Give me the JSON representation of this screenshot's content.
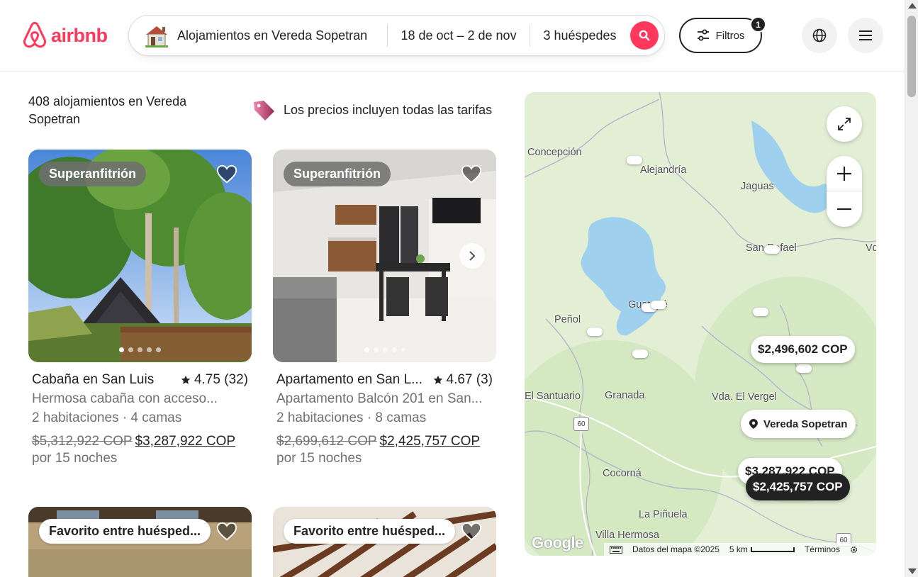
{
  "header": {
    "logo_text": "airbnb",
    "search": {
      "location": "Alojamientos en Vereda Sopetran",
      "dates": "18 de oct – 2 de nov",
      "guests": "3 huéspedes"
    },
    "filters_label": "Filtros",
    "filters_count": "1"
  },
  "results": {
    "count_text": "408 alojamientos en Vereda Sopetran",
    "price_notice": "Los precios incluyen todas las tarifas"
  },
  "listings": [
    {
      "badge": "Superanfitrión",
      "title": "Cabaña en San Luis",
      "rating": "4.75 (32)",
      "description": "Hermosa cabaña con acceso...",
      "details": "2 habitaciones · 4 camas",
      "old_price": "$5,312,922 COP",
      "new_price": "$3,287,922 COP",
      "nights": "por 15 noches"
    },
    {
      "badge": "Superanfitrión",
      "title": "Apartamento en San L...",
      "rating": "4.67 (3)",
      "description": "Apartamento Balcón 201 en San...",
      "details": "2 habitaciones · 8 camas",
      "old_price": "$2,699,612 COP",
      "new_price": "$2,425,757 COP",
      "nights": "por 15 noches"
    },
    {
      "badge": "Favorito entre huésped..."
    },
    {
      "badge": "Favorito entre huésped..."
    }
  ],
  "map": {
    "places": [
      "Concepción",
      "Alejandría",
      "Jaguas",
      "San Rafael",
      "Peñol",
      "Guatapé",
      "El Santuario",
      "Granada",
      "Vda. El Vergel",
      "Cocorná",
      "La Piñuela",
      "Villa Hermosa",
      "Vd"
    ],
    "route_60_a": "60",
    "route_60_b": "60",
    "price_pills": [
      "$2,496,602 COP",
      "$3,287,922 COP",
      "$2,425,757 COP"
    ],
    "location_label": "Vereda Sopetran",
    "footer": {
      "map_data": "Datos del mapa ©2025",
      "scale": "5 km",
      "terms": "Términos"
    },
    "google_text": "Google"
  },
  "colors": {
    "brand": "#ff385c",
    "map_land": "#e2efd5",
    "map_water": "#9fd0ee"
  }
}
